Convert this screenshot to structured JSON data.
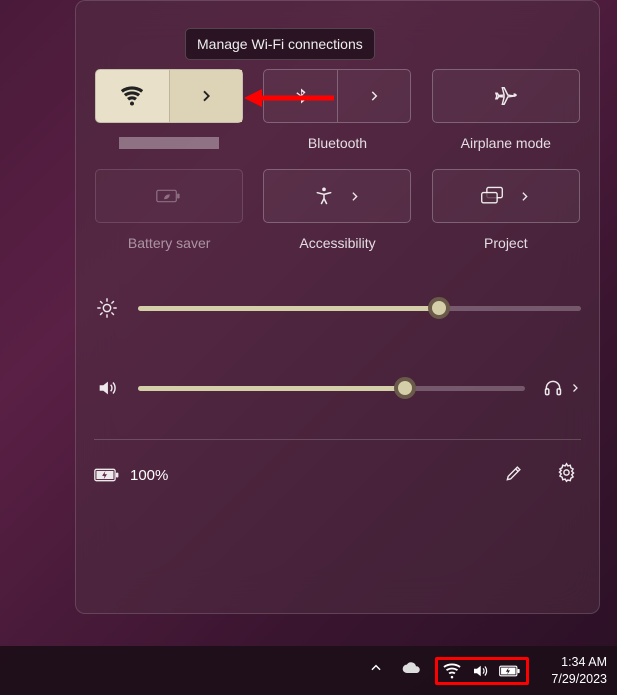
{
  "tooltip": "Manage Wi-Fi connections",
  "tiles": {
    "wifi": {
      "label": ""
    },
    "bluetooth": {
      "label": "Bluetooth"
    },
    "airplane": {
      "label": "Airplane mode"
    },
    "battery_saver": {
      "label": "Battery saver"
    },
    "accessibility": {
      "label": "Accessibility"
    },
    "project": {
      "label": "Project"
    }
  },
  "sliders": {
    "brightness": {
      "percent": 68
    },
    "volume": {
      "percent": 69
    }
  },
  "footer": {
    "battery_text": "100%"
  },
  "taskbar": {
    "time": "1:34 AM",
    "date": "7/29/2023"
  }
}
